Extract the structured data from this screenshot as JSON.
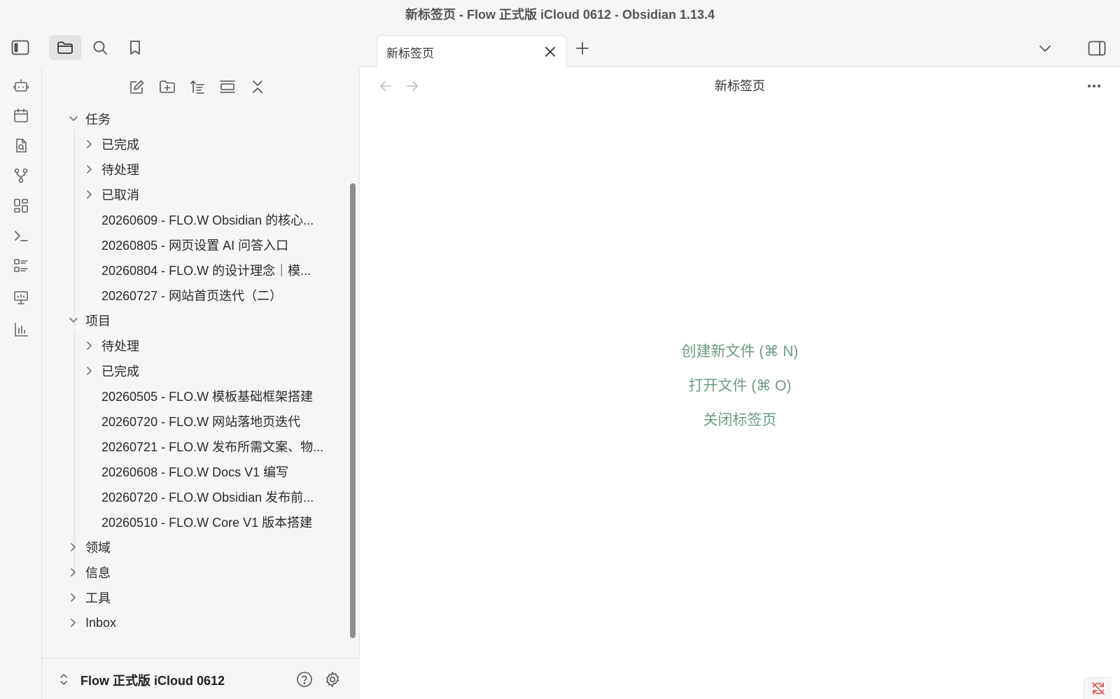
{
  "window": {
    "title": "新标签页 - Flow 正式版 iCloud 0612 - Obsidian 1.13.4"
  },
  "toolbar_left": {
    "icons": [
      "sidebar-toggle-icon",
      "folder-icon",
      "search-icon",
      "bookmark-icon"
    ],
    "active": "folder-icon"
  },
  "tabs": [
    {
      "label": "新标签页",
      "active": true
    }
  ],
  "ribbon": {
    "icons": [
      "robot-icon",
      "calendar-icon",
      "file-search-icon",
      "git-branch-icon",
      "layout-dashboard-icon",
      "terminal-icon",
      "list-checks-icon",
      "presentation-icon",
      "bar-chart-icon"
    ]
  },
  "explorer": {
    "actions": [
      "new-note-icon",
      "new-folder-icon",
      "sort-icon",
      "collapse-view-icon",
      "collapse-all-icon"
    ],
    "tree": [
      {
        "label": "任务",
        "expanded": true
      },
      {
        "label": "已完成"
      },
      {
        "label": "待处理"
      },
      {
        "label": "已取消"
      },
      {
        "label": "20260609 - FLO.W Obsidian 的核心..."
      },
      {
        "label": "20260805 - 网页设置 AI 问答入口"
      },
      {
        "label": "20260804 - FLO.W 的设计理念｜模..."
      },
      {
        "label": "20260727 - 网站首页迭代（二）"
      },
      {
        "label": "项目",
        "expanded": true
      },
      {
        "label": "待处理"
      },
      {
        "label": "已完成"
      },
      {
        "label": "20260505 - FLO.W 模板基础框架搭建"
      },
      {
        "label": "20260720 - FLO.W 网站落地页迭代"
      },
      {
        "label": "20260721 - FLO.W 发布所需文案、物..."
      },
      {
        "label": "20260608 - FLO.W Docs V1 编写"
      },
      {
        "label": "20260720 - FLO.W Obsidian 发布前..."
      },
      {
        "label": "20260510 - FLO.W Core V1 版本搭建"
      },
      {
        "label": "领域"
      },
      {
        "label": "信息"
      },
      {
        "label": "工具"
      },
      {
        "label": "Inbox"
      }
    ]
  },
  "vault": {
    "name": "Flow 正式版 iCloud 0612"
  },
  "main": {
    "title": "新标签页",
    "empty_actions": [
      "创建新文件 (⌘ N)",
      "打开文件 (⌘ O)",
      "关闭标签页"
    ]
  },
  "colors": {
    "accent_green": "#6b9c82",
    "sync_error_red": "#d94f4f"
  }
}
